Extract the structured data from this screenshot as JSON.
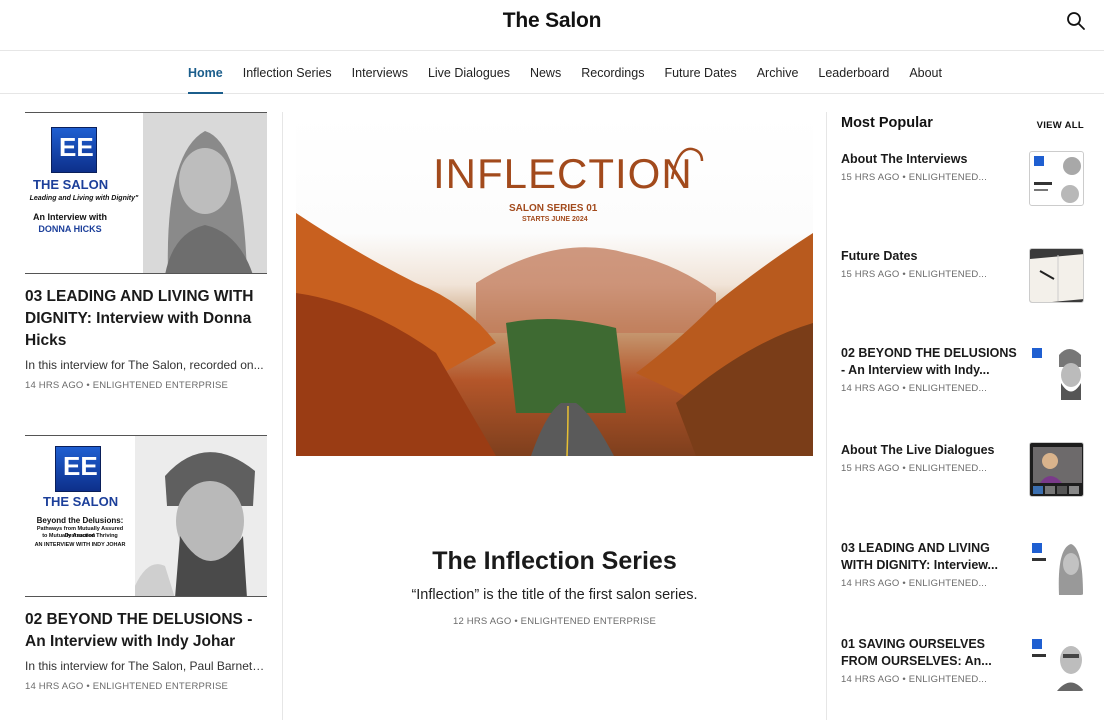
{
  "site": {
    "title": "The Salon"
  },
  "nav": {
    "items": [
      {
        "label": "Home",
        "active": true
      },
      {
        "label": "Inflection Series"
      },
      {
        "label": "Interviews"
      },
      {
        "label": "Live Dialogues"
      },
      {
        "label": "News"
      },
      {
        "label": "Recordings"
      },
      {
        "label": "Future Dates"
      },
      {
        "label": "Archive"
      },
      {
        "label": "Leaderboard"
      },
      {
        "label": "About"
      }
    ]
  },
  "left_posts": [
    {
      "title": "03 LEADING AND LIVING WITH DIGNITY: Interview with Donna Hicks",
      "excerpt": "In this interview for The Salon, recorded on...",
      "meta": "14 HRS AGO • ENLIGHTENED ENTERPRISE",
      "thumb": {
        "brand": "THE SALON",
        "tagline": "Leading and Living with Dignity\"",
        "line1": "An Interview with",
        "line2": "DONNA HICKS"
      }
    },
    {
      "title": "02 BEYOND THE DELUSIONS - An Interview with Indy Johar",
      "excerpt": "In this interview for The Salon, Paul Barnett,...",
      "meta": "14 HRS AGO • ENLIGHTENED ENTERPRISE",
      "thumb": {
        "brand": "THE SALON",
        "line1": "Beyond the Delusions:",
        "line2": "Pathways from Mutually Assured Destruction",
        "line3": "to Mutually Assured Thriving",
        "line4": "AN INTERVIEW WITH INDY JOHAR"
      }
    }
  ],
  "hero": {
    "word": "INFLECTION",
    "series": "SALON SERIES 01",
    "starts": "STARTS JUNE 2024"
  },
  "feature": {
    "title": "The Inflection Series",
    "subtitle": "“Inflection” is the title of the first salon series.",
    "meta": "12 HRS AGO • ENLIGHTENED ENTERPRISE"
  },
  "popular": {
    "heading": "Most Popular",
    "view_all": "VIEW ALL",
    "items": [
      {
        "title": "About The Interviews",
        "meta": "15 HRS AGO • ENLIGHTENED..."
      },
      {
        "title": "Future Dates",
        "meta": "15 HRS AGO • ENLIGHTENED..."
      },
      {
        "title": "02 BEYOND THE DELUSIONS - An Interview with Indy...",
        "meta": "14 HRS AGO • ENLIGHTENED..."
      },
      {
        "title": "About The Live Dialogues",
        "meta": "15 HRS AGO • ENLIGHTENED..."
      },
      {
        "title": "03 LEADING AND LIVING WITH DIGNITY: Interview...",
        "meta": "14 HRS AGO • ENLIGHTENED..."
      },
      {
        "title": "01 SAVING OURSELVES FROM OURSELVES: An...",
        "meta": "14 HRS AGO • ENLIGHTENED..."
      }
    ]
  },
  "colors": {
    "accent": "#1b5e8c",
    "hero_text": "#a24a1c",
    "logo_blue": "#1f5fd1"
  }
}
